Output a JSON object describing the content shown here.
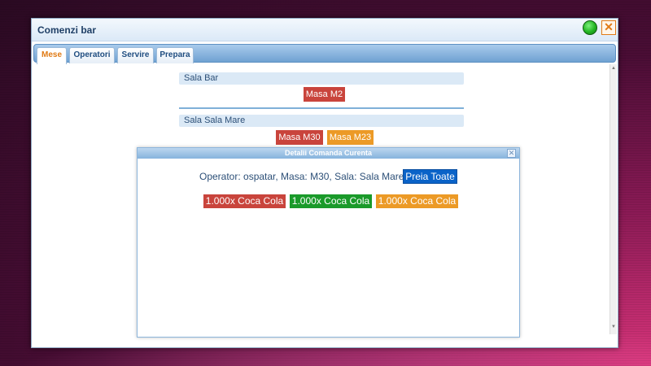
{
  "window": {
    "title": "Comenzi bar",
    "close_glyph": "✕",
    "status_color": "#22b522"
  },
  "tabs": [
    {
      "label": "Mese",
      "active": true
    },
    {
      "label": "Operatori",
      "active": false
    },
    {
      "label": "Servire",
      "active": false
    },
    {
      "label": "Prepara",
      "active": false
    }
  ],
  "sections": [
    {
      "title": "Sala Bar",
      "tables": [
        {
          "label": "Masa M2",
          "color": "#c9443c"
        }
      ]
    },
    {
      "title": "Sala Sala Mare",
      "tables": [
        {
          "label": "Masa M30",
          "color": "#c9443c"
        },
        {
          "label": "Masa M23",
          "color": "#ec9a26"
        }
      ]
    }
  ],
  "dialog": {
    "title": "Detalii Comanda Curenta",
    "close_glyph": "✕",
    "operator_line": "Operator: ospatar, Masa: M30, Sala: Sala Mare",
    "take_all_label": "Preia Toate",
    "items": [
      {
        "label": "1.000x Coca Cola",
        "color": "#c9443c"
      },
      {
        "label": "1.000x Coca Cola",
        "color": "#1a9a2a"
      },
      {
        "label": "1.000x Coca Cola",
        "color": "#ec9a26"
      }
    ]
  },
  "scrollbar": {
    "up_glyph": "▲",
    "down_glyph": "▼"
  }
}
